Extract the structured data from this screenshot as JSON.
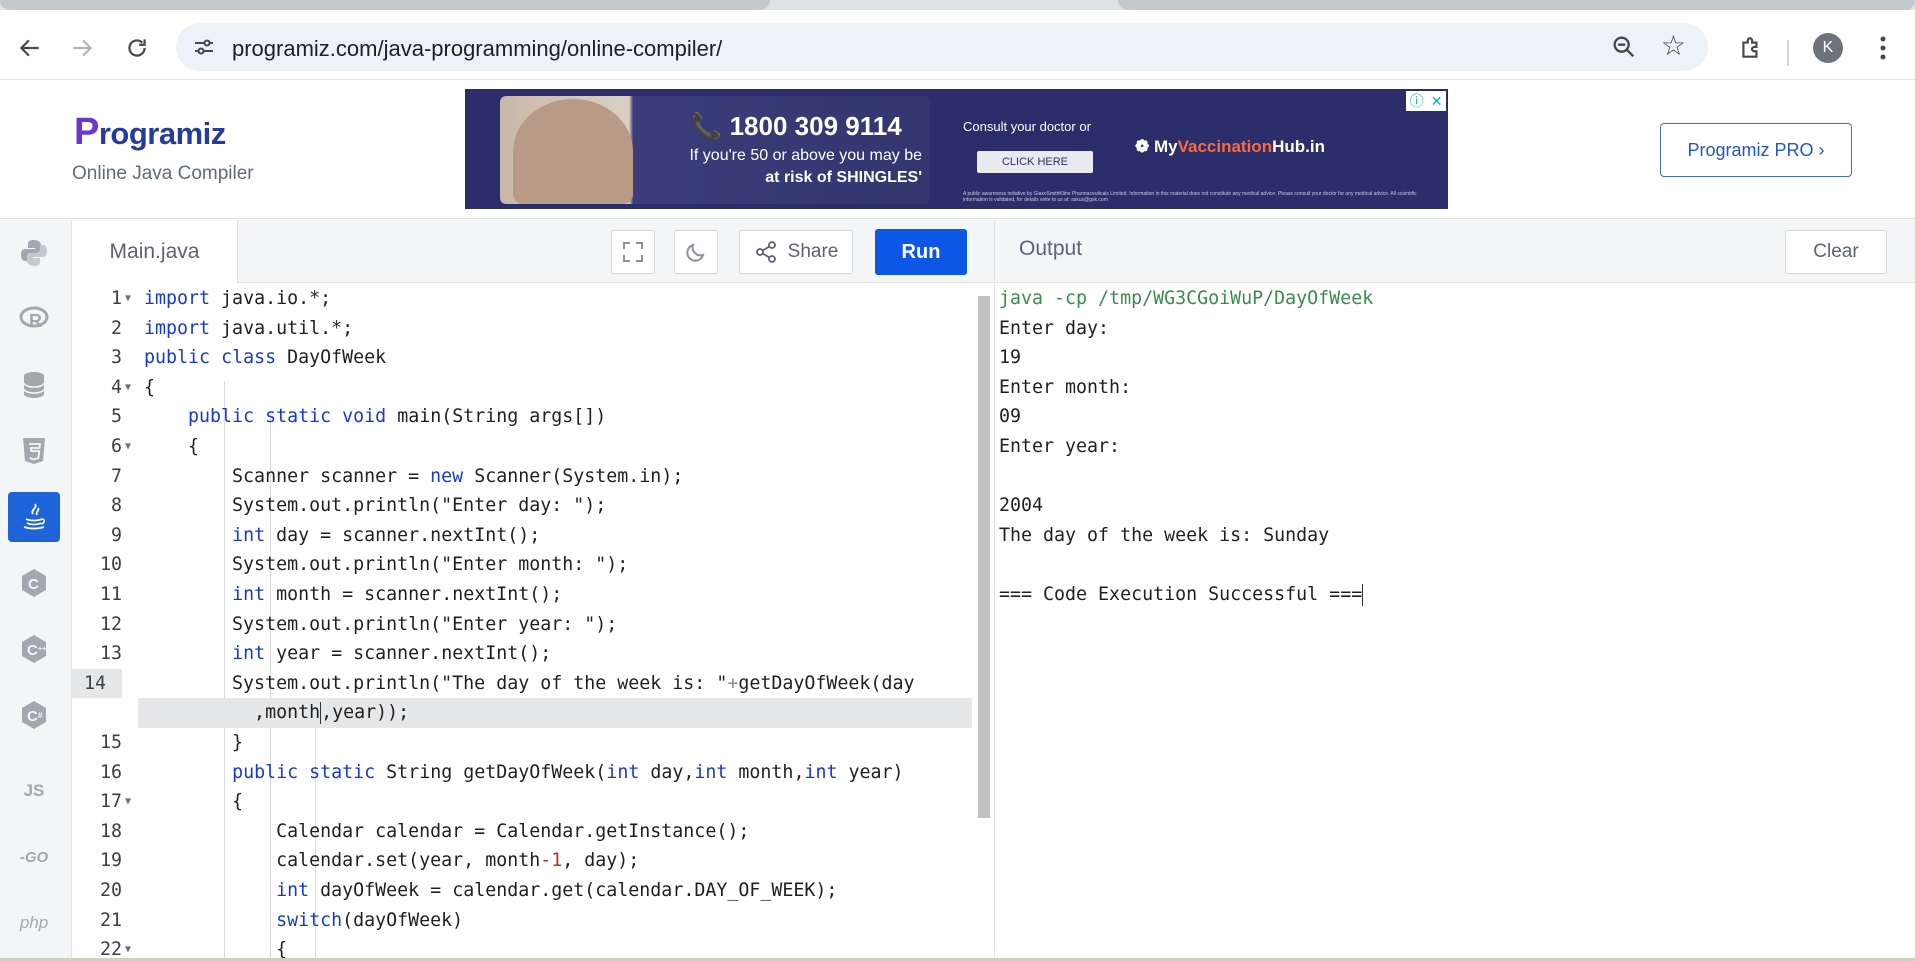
{
  "browser": {
    "url": "programiz.com/java-programming/online-compiler/",
    "profile_initial": "K"
  },
  "header": {
    "logo_text": "rogramiz",
    "logo_initial": "P",
    "subtitle": "Online Java Compiler",
    "pro_button": "Programiz PRO ›",
    "ad": {
      "phone": "📞 1800 309 9114",
      "line1": "If you're 50 or above you may be",
      "line2": "at risk of SHINGLES'",
      "consult": "Consult your doctor or",
      "cta": "CLICK HERE",
      "hub_prefix": "My",
      "hub_accent": "Vaccination",
      "hub_suffix": "Hub.in",
      "fine_print": "A public awareness initiative by GlaxoSmithKline Pharmaceuticals Limited. Information in this material does not constitute any medical advice. Please consult your doctor for any medical advice. All scientific information is validated, for details write to us at: askus@gsk.com"
    }
  },
  "sidebar": {
    "languages": [
      {
        "name": "python",
        "label": ""
      },
      {
        "name": "r",
        "label": "R"
      },
      {
        "name": "sql",
        "label": ""
      },
      {
        "name": "html",
        "label": "5"
      },
      {
        "name": "java",
        "label": ""
      },
      {
        "name": "c",
        "label": "C"
      },
      {
        "name": "cpp",
        "label": "C"
      },
      {
        "name": "csharp",
        "label": "C"
      },
      {
        "name": "js",
        "label": "JS"
      },
      {
        "name": "go",
        "label": "-GO"
      },
      {
        "name": "php",
        "label": "php"
      }
    ],
    "active": "java"
  },
  "editor": {
    "file_tab": "Main.java",
    "share_label": "Share",
    "run_label": "Run",
    "lines": [
      {
        "n": "1",
        "fold": true
      },
      {
        "n": "2"
      },
      {
        "n": "3"
      },
      {
        "n": "4",
        "fold": true
      },
      {
        "n": "5"
      },
      {
        "n": "6",
        "fold": true
      },
      {
        "n": "7"
      },
      {
        "n": "8"
      },
      {
        "n": "9"
      },
      {
        "n": "10"
      },
      {
        "n": "11"
      },
      {
        "n": "12"
      },
      {
        "n": "13"
      },
      {
        "n": "14"
      },
      {
        "n": ""
      },
      {
        "n": "15"
      },
      {
        "n": "16"
      },
      {
        "n": "17",
        "fold": true
      },
      {
        "n": "18"
      },
      {
        "n": "19"
      },
      {
        "n": "20"
      },
      {
        "n": "21"
      },
      {
        "n": "22",
        "fold": true
      }
    ]
  },
  "output": {
    "title": "Output",
    "clear_label": "Clear",
    "lines": [
      "java -cp /tmp/WG3CGoiWuP/DayOfWeek",
      "Enter day:",
      "19",
      "Enter month:",
      "09",
      "Enter year:",
      "",
      "2004",
      "The day of the week is: Sunday",
      "",
      "=== Code Execution Successful ==="
    ]
  },
  "colors": {
    "run_button": "#0c57e6",
    "keyword": "#1538d9",
    "command": "#3c8b4f",
    "logo": "#253b9e"
  }
}
